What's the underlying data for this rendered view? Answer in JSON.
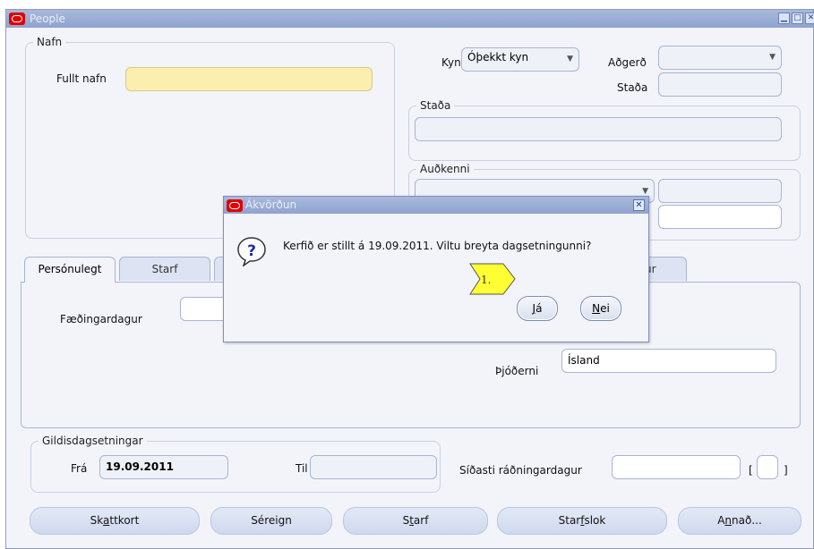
{
  "window": {
    "title": "People"
  },
  "nafn": {
    "legend": "Nafn",
    "full_name_label": "Fullt nafn",
    "full_name_value": ""
  },
  "kyn": {
    "label": "Kyn",
    "value": "Óþekkt kyn"
  },
  "adgerd": {
    "label": "Aðgerð",
    "value": ""
  },
  "stada_top": {
    "label": "Staða",
    "value": ""
  },
  "stada_group": {
    "legend": "Staða",
    "value": ""
  },
  "audkenni": {
    "legend": "Auðkenni",
    "select_value": "",
    "field1": "",
    "field2": ""
  },
  "tabs": {
    "personulegt": "Persónulegt",
    "starf": "Starf",
    "partial_right": "ur"
  },
  "personal": {
    "birthdate_label": "Fæðingardagur",
    "birthdate_value": "",
    "nationality_label": "Þjóðerni",
    "nationality_value": "Ísland"
  },
  "dates": {
    "legend": "Gildisdagsetningar",
    "from_label": "Frá",
    "from_value": "19.09.2011",
    "to_label": "Til",
    "to_value": ""
  },
  "last_hire": {
    "label": "Síðasti ráðningardagur",
    "value": ""
  },
  "bracket": {
    "open": "[",
    "close": "]"
  },
  "buttons": {
    "skattkort": {
      "before": "Sk",
      "mn": "a",
      "after": "ttkort"
    },
    "sereign": {
      "before": "Séreign",
      "mn": "",
      "after": ""
    },
    "starf": {
      "before": "S",
      "mn": "t",
      "after": "arf"
    },
    "starfslok": {
      "before": "Star",
      "mn": "f",
      "after": "slok"
    },
    "annad": {
      "before": "A",
      "mn": "n",
      "after": "nað..."
    }
  },
  "dialog": {
    "title": "Ákvörðun",
    "message": "Kerfið er stillt á 19.09.2011. Viltu breyta dagsetningunni?",
    "yes": {
      "mn": "J",
      "after": "á"
    },
    "no": {
      "mn": "N",
      "after": "ei"
    },
    "callout": "1."
  },
  "icons": [
    "oracle-logo-icon",
    "minimize-icon",
    "maximize-icon",
    "close-icon",
    "question-icon",
    "chevron-down-icon"
  ],
  "colors": {
    "title_bar": "#8fa3cf",
    "required_field": "#fbeeaf",
    "oracle_red": "#e00000",
    "callout_yellow": "#ffff33"
  }
}
